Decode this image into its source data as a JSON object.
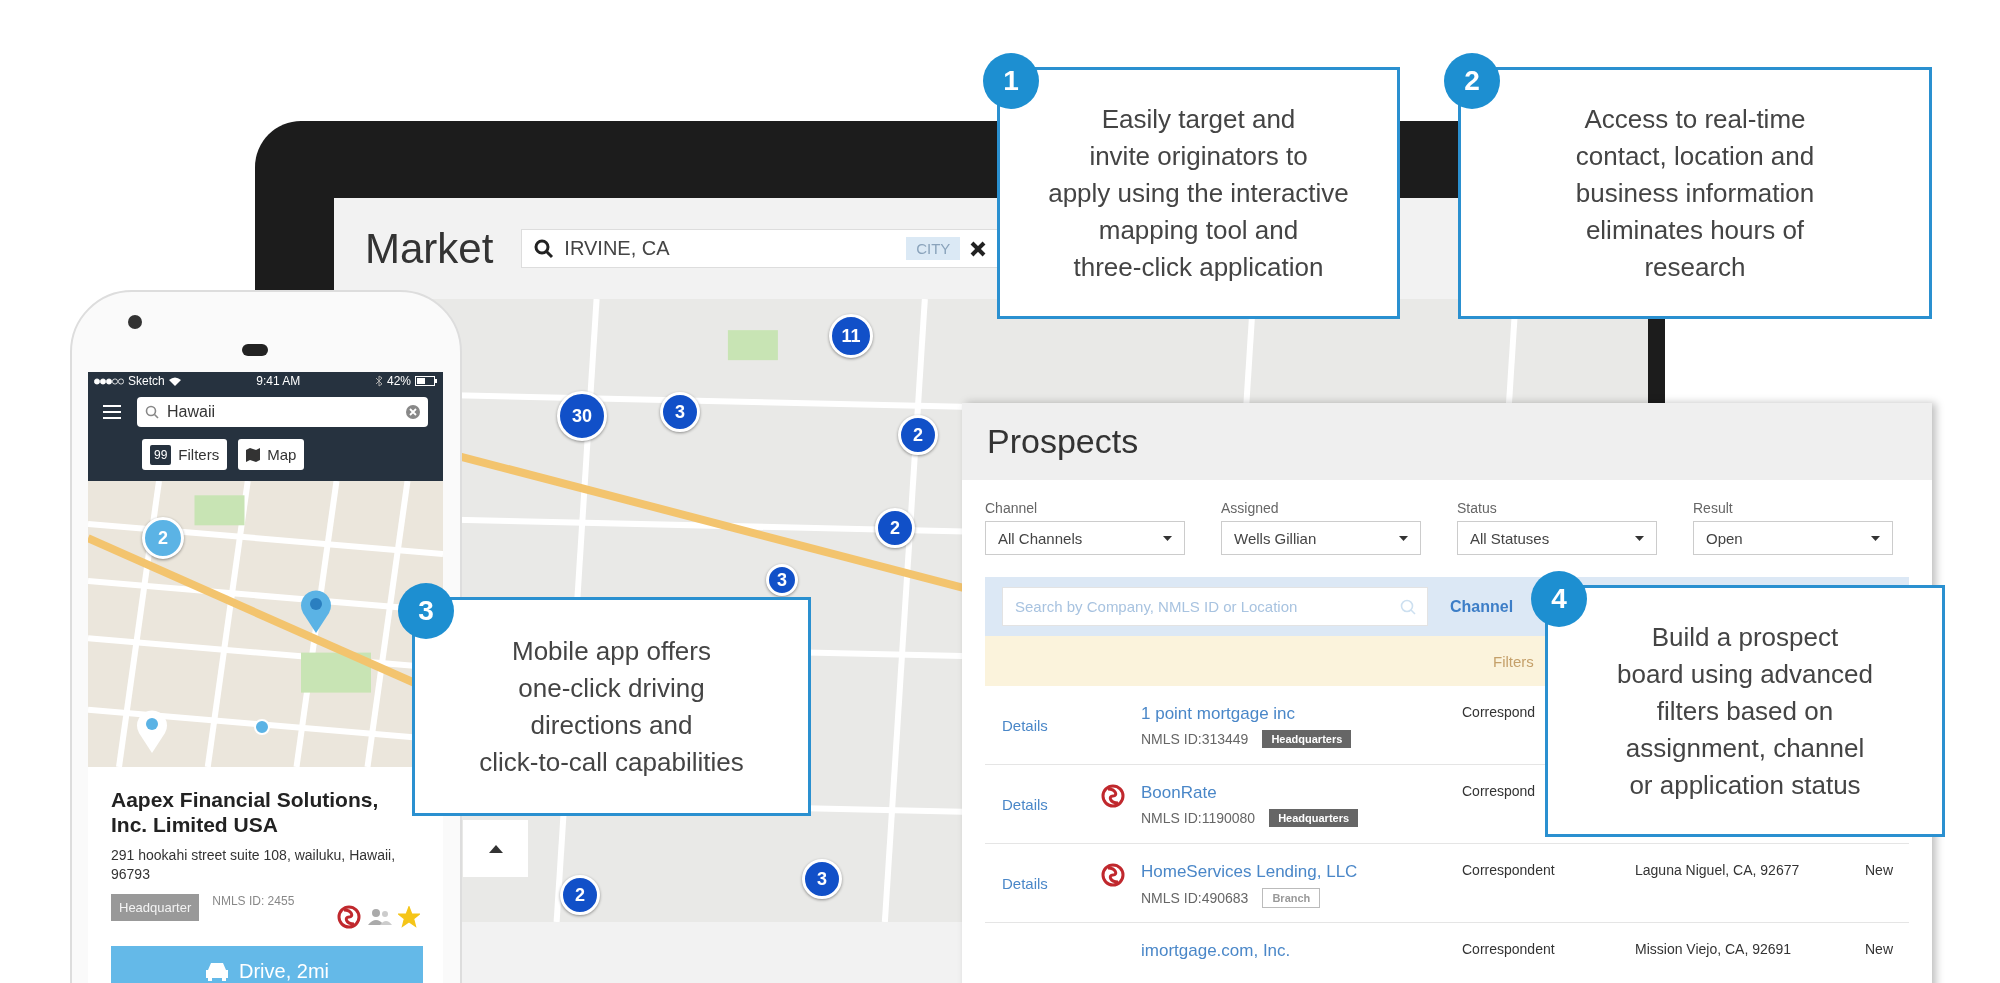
{
  "tablet": {
    "title": "Market",
    "search": {
      "value": "IRVINE, CA",
      "tag": "CITY"
    },
    "map_clusters": [
      {
        "count": "11"
      },
      {
        "count": "30"
      },
      {
        "count": "3"
      },
      {
        "count": "2"
      },
      {
        "count": "2"
      },
      {
        "count": "3"
      },
      {
        "count": "3"
      },
      {
        "count": "2"
      }
    ]
  },
  "phone": {
    "status": {
      "carrier": "Sketch",
      "time": "9:41 AM",
      "battery": "42%"
    },
    "search": {
      "value": "Hawaii"
    },
    "filters_button": {
      "count": "99",
      "label": "Filters"
    },
    "map_button": "Map",
    "map_clusters": [
      {
        "count": "2"
      }
    ],
    "listing": {
      "name": "Aapex Financial Solutions, Inc. Limited USA",
      "address": "291 hookahi street suite 108, wailuku, Hawaii, 96793",
      "tag": "Headquarter",
      "nmls": "NMLS ID: 2455",
      "starred": true
    },
    "drive_button": "Drive, 2mi"
  },
  "prospects": {
    "title": "Prospects",
    "filters": [
      {
        "label": "Channel",
        "value": "All Channels"
      },
      {
        "label": "Assigned",
        "value": "Wells Gillian"
      },
      {
        "label": "Status",
        "value": "All Statuses"
      },
      {
        "label": "Result",
        "value": "Open"
      }
    ],
    "search": {
      "placeholder": "Search by Company, NMLS ID or Location"
    },
    "column_header": "Channel",
    "filters_notice": "Filters",
    "rows": [
      {
        "action": "Details",
        "logo": false,
        "company": "1 point mortgage inc",
        "nmls": "NMLS ID:313449",
        "tag": "Headquarters",
        "kind": "headquarters",
        "channel": "Correspond"
      },
      {
        "action": "Details",
        "logo": true,
        "company": "BoonRate",
        "nmls": "NMLS ID:1190080",
        "tag": "Headquarters",
        "kind": "headquarters",
        "channel": "Correspond"
      },
      {
        "action": "Details",
        "logo": true,
        "company": "HomeServices Lending, LLC",
        "nmls": "NMLS ID:490683",
        "tag": "Branch",
        "kind": "branch",
        "channel": "Correspondent",
        "location": "Laguna Niguel, CA, 92677",
        "status": "New"
      },
      {
        "logo": false,
        "company": "imortgage.com, Inc.",
        "channel": "Correspondent",
        "location": "Mission Viejo, CA, 92691",
        "status": "New"
      }
    ]
  },
  "callouts": [
    {
      "number": "1",
      "text": "Easily target and\ninvite originators to\napply using the interactive\nmapping tool and\nthree-click application"
    },
    {
      "number": "2",
      "text": "Access to real-time\ncontact, location and\nbusiness information\neliminates hours of\nresearch"
    },
    {
      "number": "3",
      "text": "Mobile app offers\none-click driving\ndirections and\nclick-to-call capabilities"
    },
    {
      "number": "4",
      "text": "Build a prospect\nboard using advanced\nfilters based on\nassignment, channel\nor application status"
    }
  ]
}
